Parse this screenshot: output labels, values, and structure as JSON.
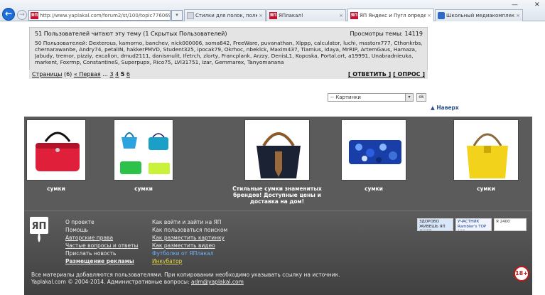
{
  "browser": {
    "address": "http://www.yaplakal.com/forum2/st/100/topic776069",
    "back_glyph": "←",
    "forward_glyph": "→",
    "addr_btns": "▾",
    "favicon_text": "ЯП",
    "tabs": [
      {
        "label": "Стилки для полок, полками с...",
        "active": false,
        "icon": "gray"
      },
      {
        "label": "ЯПлакал!",
        "active": false,
        "icon": "yp"
      },
      {
        "label": "ЯП Яндекс и Пугл определяют ...",
        "active": true,
        "icon": "yp"
      },
      {
        "label": "Школьный медиакомплекс. Понс...",
        "active": false,
        "icon": "blue"
      }
    ],
    "close_glyph": "×",
    "win_controls": {
      "minimize": "—",
      "close": "✕"
    }
  },
  "topic_info": {
    "readers_header": "51 Пользователей читают эту тему (1 Скрытых Пользователей)",
    "views_label": "Просмотры темы: 14119",
    "users_list": "50 Пользователей: Dexterous, kamorno, banchev, nick000006, soma642, FreeWare, puvanathan, Xlppp, calculator, luchi, mastorx777, Cthonkrbs, chernarawanbe, Andry74, petalIN, hakkerPMVD, Student325, ipocak79, Okrhoc, nbeklck, Maxim437, Tiamius, Idaya, MrRIP, ArtemGaus, Hamaza, Jabudy, tremor, pizziy, excalion, dmud2111, danismulit, Ifetrch, zlorty, Francplank, Arzzy, DenisL1, Koposka, Portal.ort, a19991, Unabradnieuka, markent, Foxrmp, ConstantineS, Superpupx, Rico75, LVI31751, Izar, Gemmarex, Tanyomanana",
    "pages_label": "Страницы",
    "pages_count": "(6)",
    "first_label": "« Первая",
    "ellipsis": "...",
    "pages": [
      "3",
      "4",
      "5",
      "6"
    ],
    "reply_button": "[ ОТВЕТИТЬ ]",
    "poll_button": "[ ОПРОС ]"
  },
  "jump": {
    "select_value": "-- Картинки",
    "select_arrow": "▾",
    "go_label": "ok",
    "to_top": "▲ Наверх"
  },
  "products": [
    {
      "caption": "сумки"
    },
    {
      "caption": "сумки"
    },
    {
      "caption": "Стильные сумки знаменитых брендов! Доступные цены и доставка на дом!"
    },
    {
      "caption": "сумки"
    },
    {
      "caption": "сумки"
    }
  ],
  "footer": {
    "logo_text": "ЯП",
    "col1": [
      {
        "label": "О проекте",
        "style": ""
      },
      {
        "label": "Помощь",
        "style": ""
      },
      {
        "label": "Авторские права",
        "style": "u"
      },
      {
        "label": "Частые вопросы и ответы",
        "style": "u"
      },
      {
        "label": "Прислать новость",
        "style": ""
      },
      {
        "label": "Размещение рекламы",
        "style": "u"
      }
    ],
    "col2": [
      {
        "label": "Как войти и зайти на ЯП",
        "style": ""
      },
      {
        "label": "Как пользоваться поиском",
        "style": ""
      },
      {
        "label": "Как разместить картинку",
        "style": "u"
      },
      {
        "label": "Как разместить видео",
        "style": "u"
      },
      {
        "label": "Футболки от ЯПлакал",
        "style": "blue"
      },
      {
        "label": "Инкубатор",
        "style": "yellow"
      }
    ],
    "badges": [
      "ЗДОРОВО ЖИВЕШЬ ЯП ДЖЕТ",
      "УЧАСТНИК Rambler's TOP 100",
      "Я 2400"
    ],
    "copyright_line1": "Все материалы добавляются пользователями. При копировании необходимо указывать ссылку на источник.",
    "copyright_line2_prefix": "Yaplakal.com © 2004-2014. Административные вопросы: ",
    "email": "adm@yaplakal.com",
    "age_badge": "18+"
  }
}
